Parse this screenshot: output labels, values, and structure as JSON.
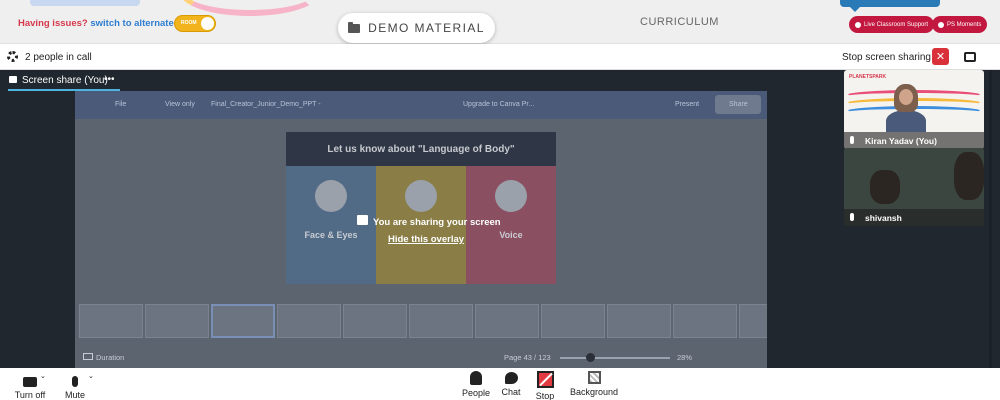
{
  "topbar": {
    "issue_label": "Having issues?",
    "switch_label": "switch to alternate room",
    "room_toggle_label": "ROOM",
    "demo_button_label": "DEMO MATERIAL",
    "curriculum_label": "CURRICULUM",
    "support_button_label": "Live Classroom Support",
    "moments_button_label": "PS Moments"
  },
  "callbar": {
    "people_count": "2 people in call",
    "stop_sharing_label": "Stop screen sharing",
    "close_label": "✕"
  },
  "stage": {
    "share_tab_label": "Screen share (You)",
    "more_label": "•••",
    "overlay_message": "You are sharing your screen",
    "hide_overlay_label": "Hide this overlay"
  },
  "shared_screen": {
    "menu_file": "File",
    "menu_view": "View only",
    "doc_title": "Final_Creator_Junior_Demo_PPT -",
    "upgrade_label": "Upgrade to Canva Pr...",
    "present_label": "Present",
    "share_label": "Share",
    "slide_title": "Let us know about \"Language of Body\"",
    "columns": [
      "Face & Eyes",
      "",
      "Voice"
    ],
    "duration_label": "Duration",
    "page_label": "Page 43 / 123",
    "zoom_label": "28%"
  },
  "participants": [
    {
      "name": "Kiran Yadav (You)"
    },
    {
      "name": "shivansh"
    }
  ],
  "controls": {
    "camera_label": "Turn off",
    "mic_label": "Mute",
    "people_label": "People",
    "chat_label": "Chat",
    "stop_label": "Stop",
    "background_label": "Background"
  },
  "colors": {
    "accent_red": "#d9303a",
    "brand_pink": "#c2183f",
    "link_blue": "#2f7dcf",
    "stage_bg": "#20272f",
    "tab_underline": "#4fb3e0"
  }
}
